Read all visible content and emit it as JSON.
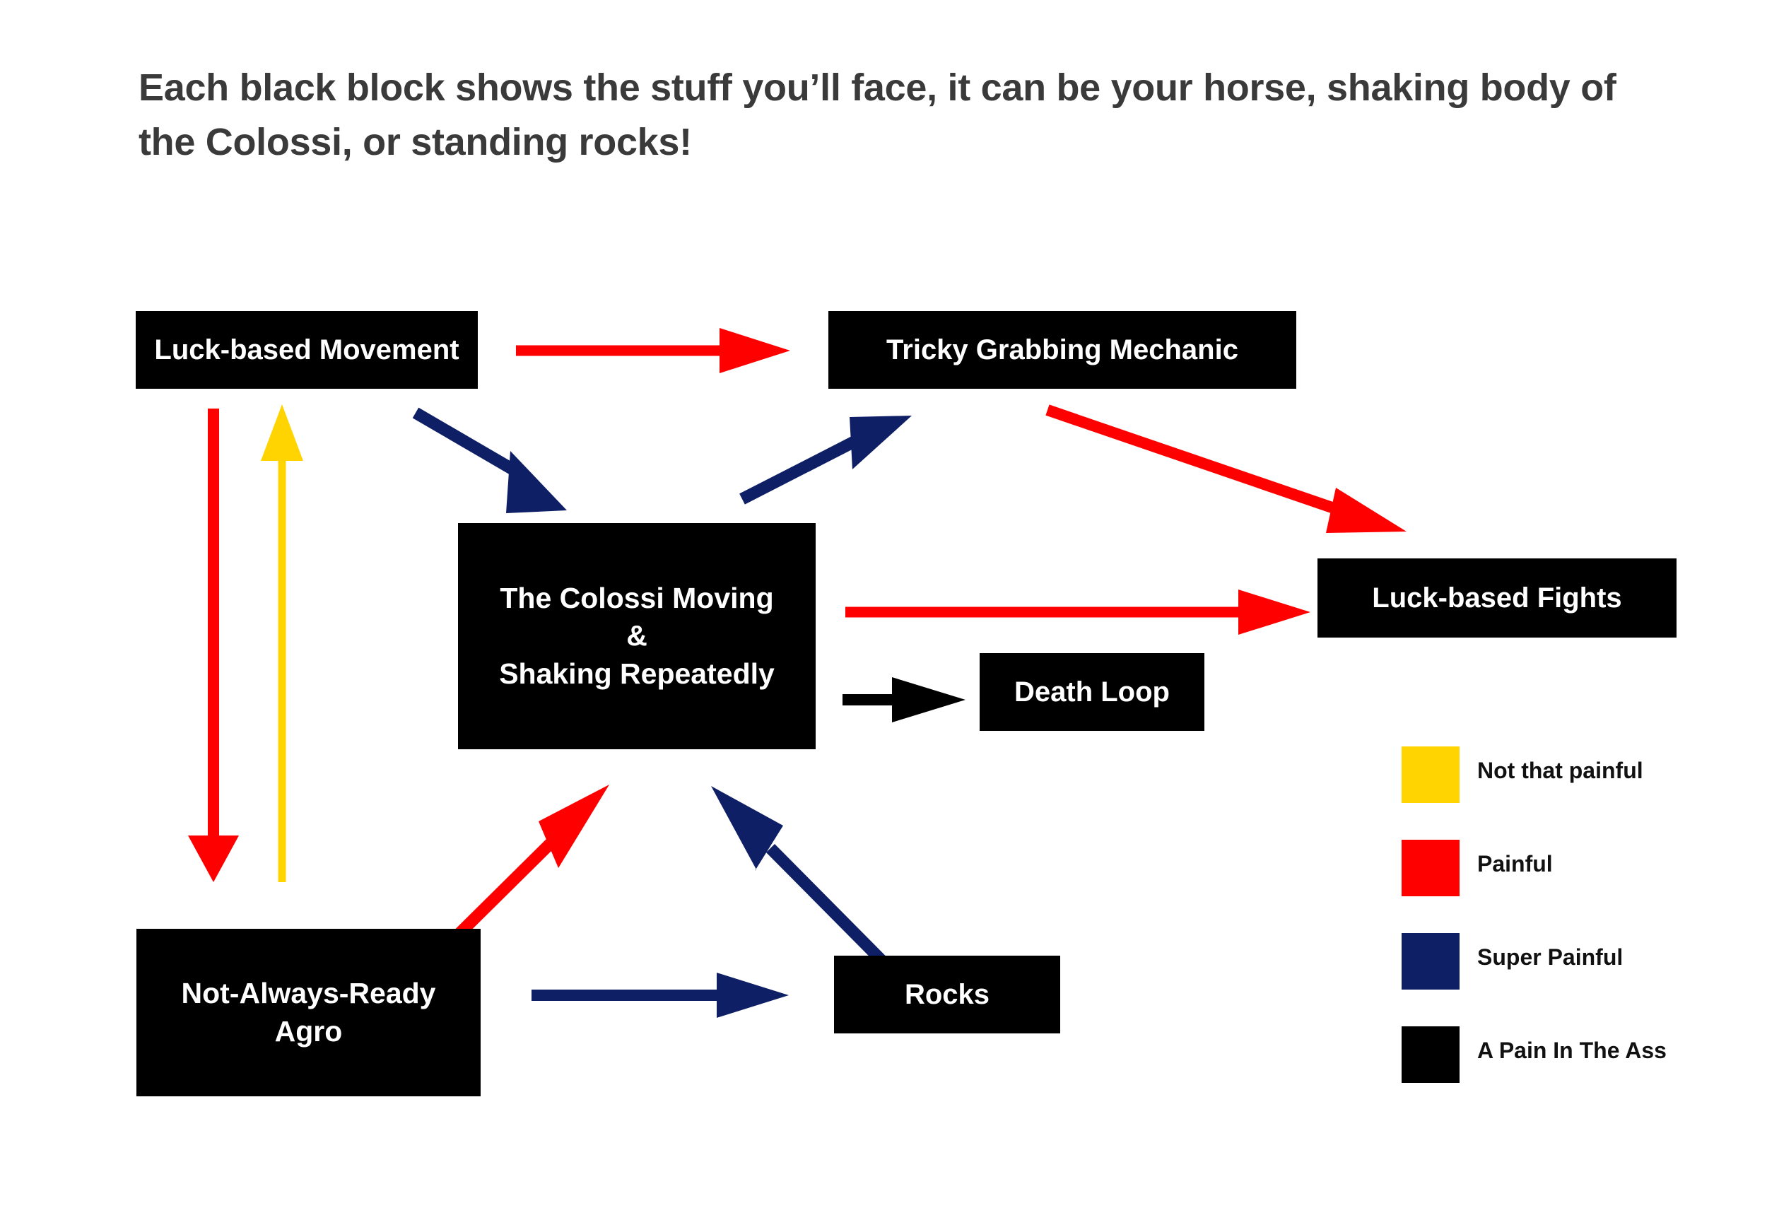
{
  "title": "Each black block shows the stuff you’ll face, it can be your horse, shaking body of the Colossi, or standing rocks!",
  "colors": {
    "not_that_painful": "#FFD400",
    "painful": "#FF0000",
    "super_painful": "#0E1F66",
    "pain_in_the_ass": "#000000",
    "node_background": "#000000",
    "node_text": "#FFFFFF",
    "title_text": "#3A3A3A",
    "page_background": "#FFFFFF"
  },
  "nodes": {
    "luck_movement": "Luck-based Movement",
    "tricky_grab": "Tricky Grabbing Mechanic",
    "colossi": "The Colossi Moving\n&\nShaking Repeatedly",
    "death_loop": "Death Loop",
    "luck_fights": "Luck-based Fights",
    "agro": "Not-Always-Ready\nAgro",
    "rocks": "Rocks"
  },
  "legend": {
    "items": [
      {
        "label": "Not that painful",
        "color": "#FFD400"
      },
      {
        "label": "Painful",
        "color": "#FF0000"
      },
      {
        "label": "Super Painful",
        "color": "#0E1F66"
      },
      {
        "label": "A Pain In The Ass",
        "color": "#000000"
      }
    ]
  },
  "edges": [
    {
      "from": "luck_movement",
      "to": "tricky_grab",
      "severity": "Painful",
      "color": "#FF0000"
    },
    {
      "from": "luck_movement",
      "to": "colossi",
      "severity": "Super Painful",
      "color": "#0E1F66"
    },
    {
      "from": "luck_movement",
      "to": "agro",
      "severity": "Painful",
      "color": "#FF0000"
    },
    {
      "from": "agro",
      "to": "luck_movement",
      "severity": "Not that painful",
      "color": "#FFD400"
    },
    {
      "from": "colossi",
      "to": "tricky_grab",
      "severity": "Super Painful",
      "color": "#0E1F66"
    },
    {
      "from": "tricky_grab",
      "to": "luck_fights",
      "severity": "Painful",
      "color": "#FF0000"
    },
    {
      "from": "colossi",
      "to": "luck_fights",
      "severity": "Painful",
      "color": "#FF0000"
    },
    {
      "from": "colossi",
      "to": "death_loop",
      "severity": "A Pain In The Ass",
      "color": "#000000"
    },
    {
      "from": "agro",
      "to": "colossi",
      "severity": "Painful",
      "color": "#FF0000"
    },
    {
      "from": "rocks",
      "to": "colossi",
      "severity": "Super Painful",
      "color": "#0E1F66"
    },
    {
      "from": "agro",
      "to": "rocks",
      "severity": "Super Painful",
      "color": "#0E1F66"
    }
  ]
}
